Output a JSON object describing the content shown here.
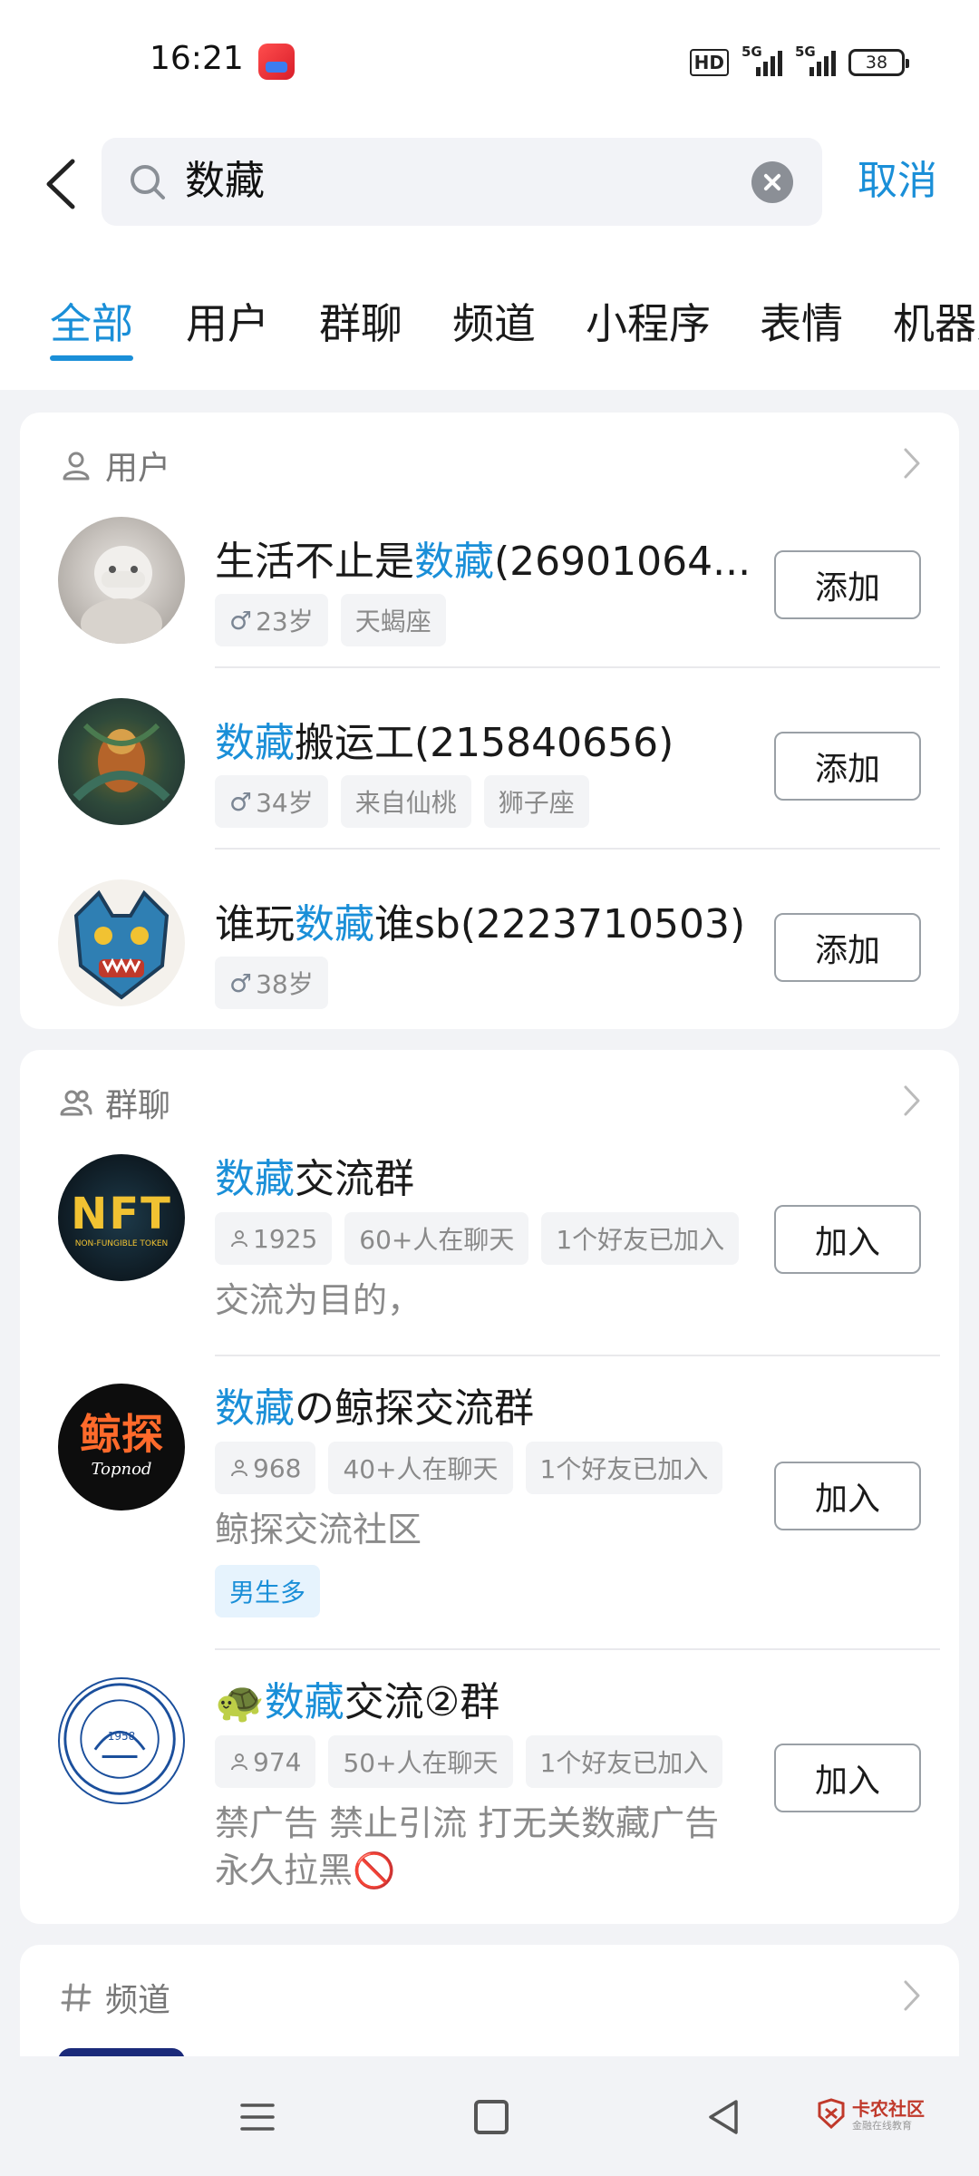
{
  "status_bar": {
    "time": "16:21",
    "signal1": "5G",
    "signal2": "5G",
    "battery": "38",
    "hd": "HD"
  },
  "search": {
    "query": "数藏",
    "cancel_label": "取消"
  },
  "tabs": [
    "全部",
    "用户",
    "群聊",
    "频道",
    "小程序",
    "表情",
    "机器人"
  ],
  "users_section": {
    "title": "用户",
    "items": [
      {
        "name_pre": "生活不止是",
        "highlight": "数藏",
        "name_post": "(26901064...",
        "tags": [
          "23岁",
          "天蝎座"
        ],
        "gender": "♂",
        "button": "添加"
      },
      {
        "name_pre": "",
        "highlight": "数藏",
        "name_post": "搬运工(215840656)",
        "tags": [
          "34岁",
          "来自仙桃",
          "狮子座"
        ],
        "gender": "♂",
        "button": "添加"
      },
      {
        "name_pre": "谁玩",
        "highlight": "数藏",
        "name_post": "谁sb(2223710503)",
        "tags": [
          "38岁"
        ],
        "gender": "♂",
        "button": "添加"
      }
    ]
  },
  "groups_section": {
    "title": "群聊",
    "items": [
      {
        "name_pre": "",
        "highlight": "数藏",
        "name_post": "交流群",
        "members": "1925",
        "tags": [
          "60+人在聊天",
          "1个好友已加入"
        ],
        "desc": "交流为目的，",
        "extra_tag": "",
        "button": "加入",
        "avatar_text": "NFT",
        "avatar_sub": "NON-FUNGIBLE TOKEN"
      },
      {
        "name_pre": "",
        "highlight": "数藏",
        "name_post": "の鲸探交流群",
        "members": "968",
        "tags": [
          "40+人在聊天",
          "1个好友已加入"
        ],
        "desc": "鲸探交流社区",
        "extra_tag": "男生多",
        "button": "加入",
        "avatar_text": "鲸探",
        "avatar_sub": "Topnod"
      },
      {
        "name_pre": "🐢",
        "highlight": "数藏",
        "name_post": "交流②群",
        "members": "974",
        "tags": [
          "50+人在聊天",
          "1个好友已加入"
        ],
        "desc": "禁广告  禁止引流  打无关数藏广告永久拉黑🚫",
        "extra_tag": "",
        "button": "加入",
        "avatar_text": "1958",
        "avatar_sub": ""
      }
    ]
  },
  "channels_section": {
    "title": "频道"
  },
  "watermark": {
    "title": "卡农社区",
    "subtitle": "金融在线教育"
  },
  "colors": {
    "accent": "#1a8fd8",
    "background": "#f2f3f6"
  }
}
